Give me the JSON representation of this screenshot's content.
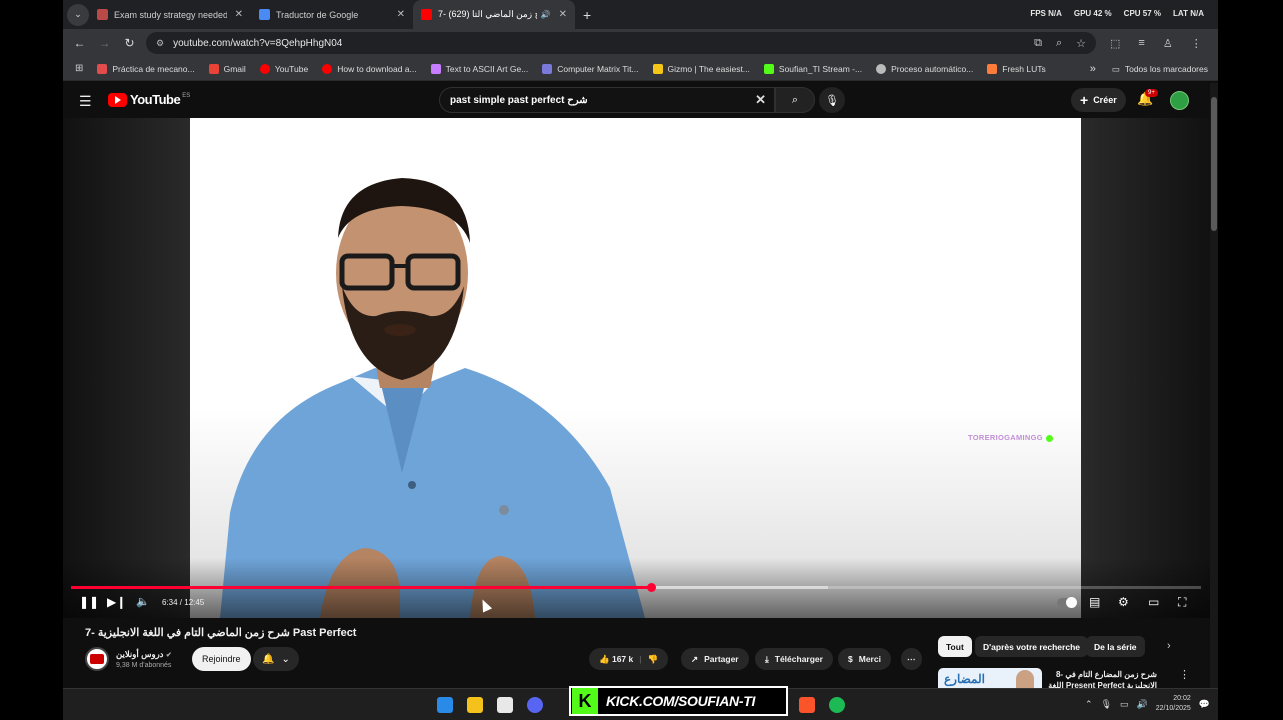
{
  "browser": {
    "tabs": [
      {
        "label": "Exam study strategy needed - C",
        "color": "#b94a48",
        "active": false
      },
      {
        "label": "Traductor de Google",
        "color": "#4a8af4",
        "active": false
      },
      {
        "label": "7- شرح زمن الماضي التا (629)",
        "color": "#ff0000",
        "active": true
      }
    ],
    "perf": {
      "fps": "FPS  N/A",
      "gpu": "GPU  42 %",
      "cpu": "CPU  57 %",
      "lat": "LAT  N/A"
    },
    "url": "youtube.com/watch?v=8QehpHhgN04",
    "bookmarks": [
      {
        "label": "Práctica de mecano...",
        "color": "#e34c4c"
      },
      {
        "label": "Gmail",
        "color": "#ea4335"
      },
      {
        "label": "YouTube",
        "color": "#ff0000"
      },
      {
        "label": "How to download a...",
        "color": "#ff0000"
      },
      {
        "label": "Text to ASCII Art Ge...",
        "color": "#c77dff"
      },
      {
        "label": "Computer Matrix Tit...",
        "color": "#7a7adb"
      },
      {
        "label": "Gizmo | The easiest...",
        "color": "#f5c518"
      },
      {
        "label": "Soufian_TI Stream -...",
        "color": "#53fc18"
      },
      {
        "label": "Proceso automático...",
        "color": "#bbbbbb"
      },
      {
        "label": "Fresh LUTs",
        "color": "#ff7b39"
      }
    ],
    "bookmarks_more": "»",
    "all_bookmarks": "Todos los marcadores"
  },
  "youtube": {
    "logo": "YouTube",
    "country": "ES",
    "search_value": "past simple past perfect شرح",
    "create_label": "Créer",
    "notif_badge": "9+"
  },
  "player": {
    "watermark": "TORERIOGAMINGG",
    "time": "6:34 / 12:45",
    "progress": 0.513,
    "buffered": 0.67
  },
  "video": {
    "title": "7- شرح زمن الماضي التام في اللغة الانجليزية Past Perfect",
    "channel": "دروس أونلاين",
    "subscribers": "9,38 M d'abonnés",
    "join_label": "Rejoindre",
    "likes": "167 k",
    "share_label": "Partager",
    "download_label": "Télécharger",
    "thanks_label": "Merci"
  },
  "sidebar": {
    "chips": [
      "Tout",
      "D'après votre recherche",
      "De la série"
    ],
    "reco_thumb_text": "المضارع",
    "reco_title": "8- شرح زمن المضارع التام في اللغة Present Perfect الانجليزية"
  },
  "overlay": {
    "kick_text": "KICK.COM/SOUFIAN-TI"
  },
  "taskbar": {
    "time": "20:02",
    "date": "22/10/2025"
  }
}
